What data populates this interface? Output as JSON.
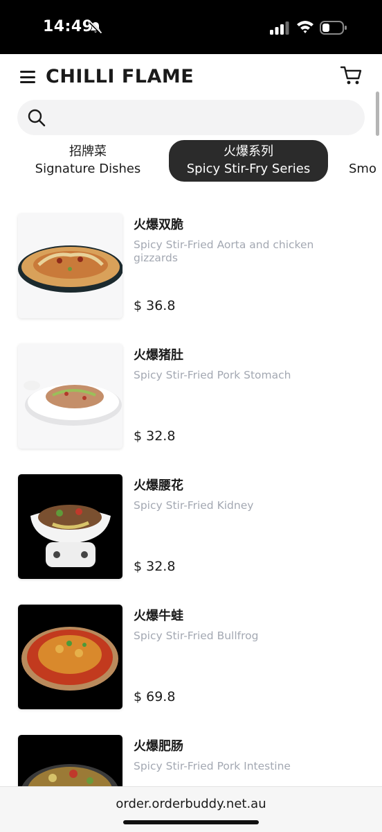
{
  "status_bar": {
    "time": "14:49"
  },
  "header": {
    "brand": "CHILLI FLAME"
  },
  "search": {
    "placeholder": ""
  },
  "tabs": [
    {
      "zh": "招牌菜",
      "en": "Signature Dishes",
      "active": false
    },
    {
      "zh": "火爆系列",
      "en": "Spicy Stir-Fry Series",
      "active": true
    },
    {
      "zh": "",
      "en": "Smo",
      "active": false
    }
  ],
  "dishes": [
    {
      "name": "火爆双脆",
      "desc": "Spicy Stir-Fried Aorta and chicken gizzards",
      "price": "$ 36.8"
    },
    {
      "name": "火爆猪肚",
      "desc": "Spicy Stir-Fried Pork Stomach",
      "price": "$ 32.8"
    },
    {
      "name": "火爆腰花",
      "desc": "Spicy Stir-Fried Kidney",
      "price": "$ 32.8"
    },
    {
      "name": "火爆牛蛙",
      "desc": "Spicy Stir-Fried Bullfrog",
      "price": "$ 69.8"
    },
    {
      "name": "火爆肥肠",
      "desc": "Spicy Stir-Fried Pork Intestine",
      "price": ""
    }
  ],
  "bottom_bar": {
    "url": "order.orderbuddy.net.au"
  },
  "colors": {
    "active_tab": "#2b2b2b",
    "desc_text": "#a3a8b2",
    "search_bg": "#f3f3f4"
  },
  "icons": [
    "bell-slash-icon",
    "signal-icon",
    "wifi-icon",
    "battery-icon",
    "menu-icon",
    "cart-icon",
    "search-icon"
  ]
}
